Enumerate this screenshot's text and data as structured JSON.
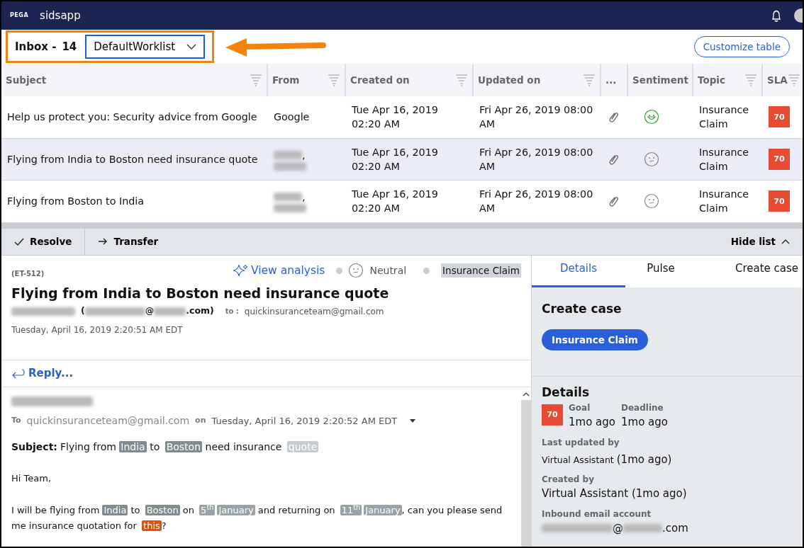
{
  "app": {
    "logo": "PEGA",
    "title": "sidsapp"
  },
  "toolbar": {
    "inbox_label": "Inbox -",
    "inbox_count": "14",
    "worklist": "DefaultWorklist",
    "customize": "Customize table"
  },
  "table": {
    "columns": [
      "Subject",
      "From",
      "Created on",
      "Updated on",
      "...",
      "Sentiment",
      "Topic",
      "SLA"
    ],
    "rows": [
      {
        "subject": "Help us protect you: Security advice from Google",
        "from": "Google",
        "from_redacted": false,
        "created": "Tue Apr 16, 2019 02:20 AM",
        "updated": "Fri Apr 26, 2019 08:00 AM",
        "sentiment": {
          "kind": "positive"
        },
        "topic": "Insurance Claim",
        "sla": "70",
        "selected": false
      },
      {
        "subject": "Flying from India to Boston need insurance quote",
        "from": ",",
        "from_redacted": true,
        "created": "Tue Apr 16, 2019 02:20 AM",
        "updated": "Fri Apr 26, 2019 08:00 AM",
        "sentiment": {
          "kind": "neutral"
        },
        "topic": "Insurance Claim",
        "sla": "70",
        "selected": true
      },
      {
        "subject": "Flying from Boston to India",
        "from": ",",
        "from_redacted": true,
        "created": "Tue Apr 16, 2019 02:20 AM",
        "updated": "Fri Apr 26, 2019 08:00 AM",
        "sentiment": {
          "kind": "neutral"
        },
        "topic": "Insurance Claim",
        "sla": "70",
        "selected": false
      }
    ]
  },
  "actions": {
    "resolve": "Resolve",
    "transfer": "Transfer",
    "hide": "Hide list"
  },
  "message": {
    "id": "(ET-512)",
    "analysis": "View analysis",
    "sentiment": {
      "kind": "neutral",
      "label": "Neutral"
    },
    "topic": "Insurance Claim",
    "title": "Flying from India to Boston need insurance quote",
    "sender": [
      {
        "kind": "redacted"
      },
      {
        "kind": "text",
        "text": "("
      },
      {
        "kind": "redacted"
      },
      {
        "kind": "text",
        "text": "@"
      },
      {
        "kind": "redacted"
      },
      {
        "kind": "text",
        "text": ".com)"
      }
    ],
    "to_label": "to :",
    "to": "quickinsuranceteam@gmail.com",
    "date": "Tuesday, April 16, 2019 2:20:51 AM EDT",
    "reply": "Reply..."
  },
  "email": {
    "to_label": "To",
    "to": "quickinsuranceteam@gmail.com",
    "on_label": "on",
    "date": "Tuesday, April 16, 2019 2:20:52 AM EDT",
    "subject_label": "Subject:",
    "subject": [
      {
        "kind": "plain",
        "text": "Flying from "
      },
      {
        "kind": "place",
        "text": "India"
      },
      {
        "kind": "plain",
        "text": " to "
      },
      {
        "kind": "place",
        "text": "Boston"
      },
      {
        "kind": "plain",
        "text": " need insurance "
      },
      {
        "kind": "faded",
        "text": "quote"
      }
    ],
    "greeting": "Hi Team,",
    "body": [
      {
        "kind": "plain",
        "text": "I will be flying from "
      },
      {
        "kind": "place",
        "text": "India"
      },
      {
        "kind": "plain",
        "text": " to "
      },
      {
        "kind": "place",
        "text": "Boston"
      },
      {
        "kind": "plain",
        "text": " on "
      },
      {
        "kind": "date",
        "text": "5$^{th}$"
      },
      {
        "kind": "date",
        "text": "January"
      },
      {
        "kind": "plain",
        "text": " and returning on "
      },
      {
        "kind": "date",
        "text": "11$^{th}$"
      },
      {
        "kind": "date",
        "text": "January"
      },
      {
        "kind": "plain",
        "text": ", can you please send me insurance quotation for "
      },
      {
        "kind": "flag",
        "text": "this"
      },
      {
        "kind": "plain",
        "text": "?"
      }
    ]
  },
  "side": {
    "tabs": [
      {
        "label": "Details",
        "selected": true
      },
      {
        "label": "Pulse",
        "selected": false
      },
      {
        "label": "Create case",
        "selected": false
      }
    ],
    "create_title": "Create case",
    "create_button": "Insurance Claim",
    "details_title": "Details",
    "sla": "70",
    "goal_label": "Goal",
    "goal": "1mo ago",
    "deadline_label": "Deadline",
    "deadline": "1mo ago",
    "updated_label": "Last updated by",
    "updated_by": "Virtual Assistant",
    "updated_when": "(1mo ago)",
    "created_label": "Created by",
    "created_by": "Virtual Assistant (1mo ago)",
    "inbound_label": "Inbound email account",
    "inbound": [
      {
        "kind": "redacted"
      },
      {
        "kind": "text",
        "text": "@"
      },
      {
        "kind": "redacted"
      },
      {
        "kind": "text",
        "text": ".com"
      }
    ]
  }
}
